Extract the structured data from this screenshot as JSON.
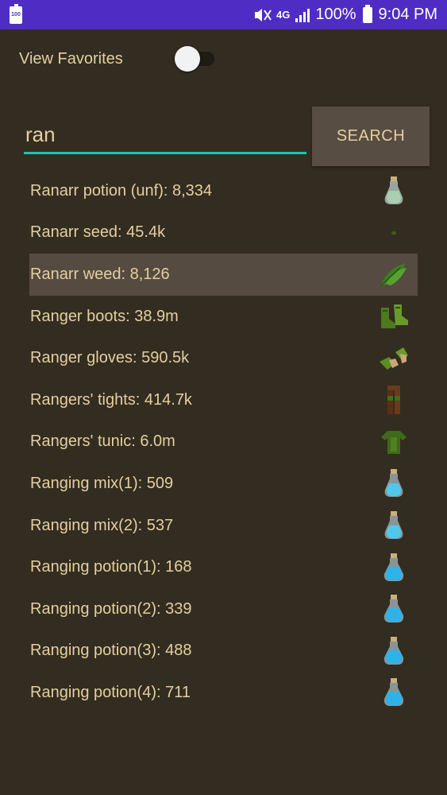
{
  "status_bar": {
    "battery_small": "100",
    "network": "4G",
    "battery_percent": "100%",
    "time": "9:04 PM"
  },
  "favorites": {
    "label": "View Favorites",
    "toggle_on": false
  },
  "search": {
    "query": "ran",
    "button_label": "SEARCH"
  },
  "colors": {
    "background": "#332c21",
    "status_bar": "#4f2dc4",
    "text": "#e4cf9e",
    "accent": "#21c2a8",
    "button": "#574d42",
    "selected_row": "#564b40"
  },
  "results": [
    {
      "text": "Ranarr potion (unf): 8,334",
      "icon": "herb-potion-vial-icon"
    },
    {
      "text": "Ranarr seed: 45.4k",
      "icon": "seed-icon"
    },
    {
      "text": "Ranarr weed: 8,126",
      "icon": "herb-leaf-icon",
      "selected": true
    },
    {
      "text": "Ranger boots: 38.9m",
      "icon": "boots-icon"
    },
    {
      "text": "Ranger gloves: 590.5k",
      "icon": "gloves-icon"
    },
    {
      "text": "Rangers' tights: 414.7k",
      "icon": "tights-icon"
    },
    {
      "text": "Rangers' tunic: 6.0m",
      "icon": "tunic-icon"
    },
    {
      "text": "Ranging mix(1): 509",
      "icon": "mix-vial-icon"
    },
    {
      "text": "Ranging mix(2): 537",
      "icon": "mix-vial-icon"
    },
    {
      "text": "Ranging potion(1): 168",
      "icon": "potion-vial-icon"
    },
    {
      "text": "Ranging potion(2): 339",
      "icon": "potion-vial-icon"
    },
    {
      "text": "Ranging potion(3): 488",
      "icon": "potion-vial-icon"
    },
    {
      "text": "Ranging potion(4): 711",
      "icon": "potion-vial-icon"
    }
  ]
}
